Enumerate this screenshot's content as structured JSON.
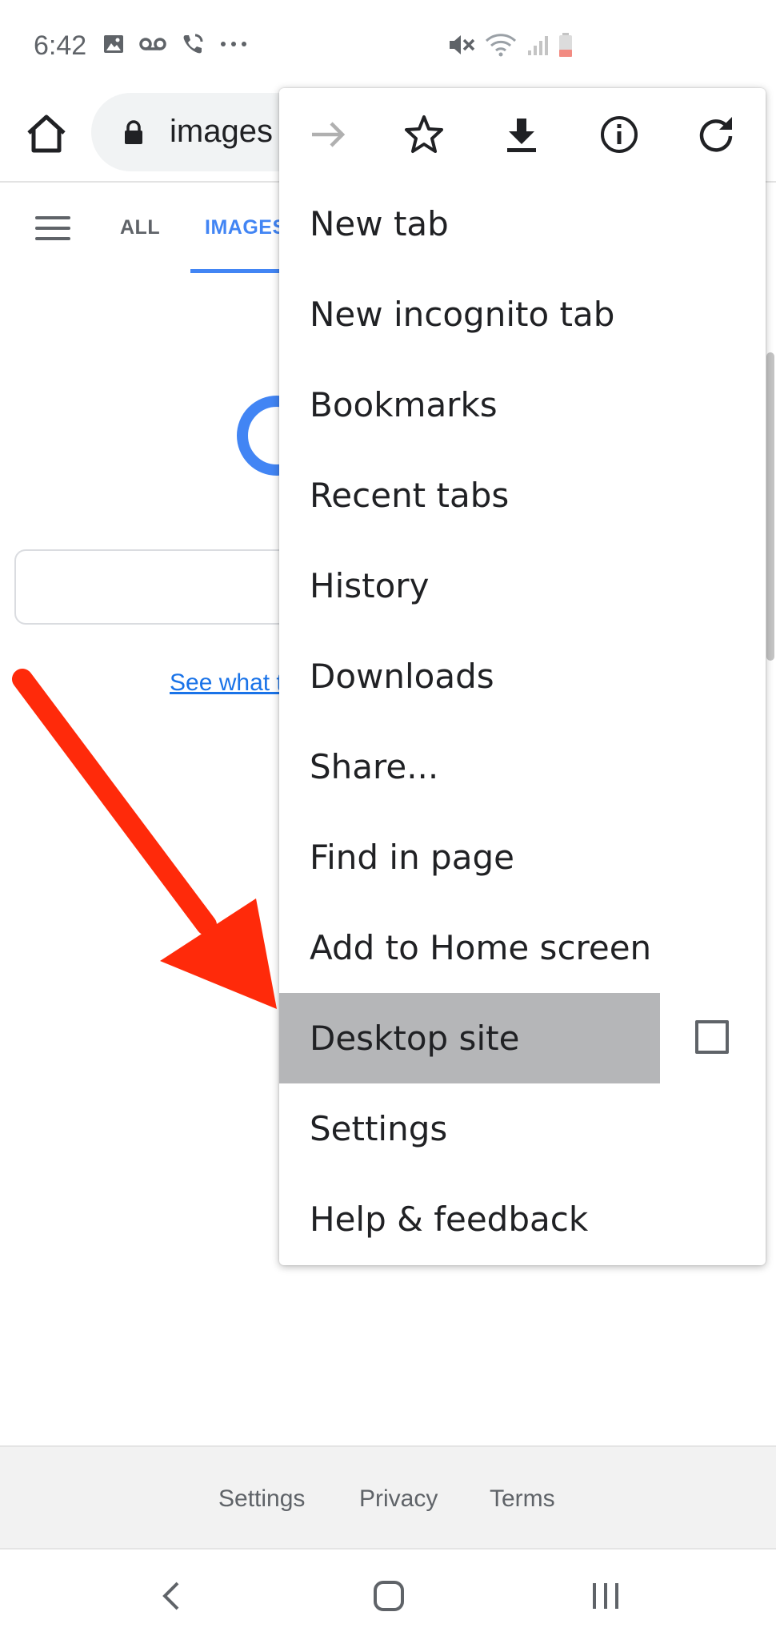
{
  "status_bar": {
    "time": "6:42",
    "left_icons": [
      "gallery-icon",
      "voicemail-icon",
      "wifi-calling-icon",
      "more-dots-icon"
    ],
    "right_icons": [
      "mute-icon",
      "wifi-icon",
      "signal-icon",
      "battery-low-icon"
    ]
  },
  "toolbar": {
    "url_text": "images",
    "icons": [
      "home-icon",
      "lock-icon"
    ]
  },
  "page": {
    "tabs": [
      "ALL",
      "IMAGES"
    ],
    "active_tab": "IMAGES",
    "link_text": "See what t"
  },
  "menu": {
    "top_icons": [
      "forward-icon",
      "star-icon",
      "download-icon",
      "info-icon",
      "refresh-icon"
    ],
    "items": [
      {
        "label": "New tab"
      },
      {
        "label": "New incognito tab"
      },
      {
        "label": "Bookmarks"
      },
      {
        "label": "Recent tabs"
      },
      {
        "label": "History"
      },
      {
        "label": "Downloads"
      },
      {
        "label": "Share..."
      },
      {
        "label": "Find in page"
      },
      {
        "label": "Add to Home screen"
      },
      {
        "label": "Desktop site",
        "highlighted": true,
        "checkbox": false
      },
      {
        "label": "Settings"
      },
      {
        "label": "Help & feedback"
      }
    ]
  },
  "footer": {
    "links": [
      "Settings",
      "Privacy",
      "Terms"
    ]
  },
  "nav_bar": {
    "icons": [
      "back-icon",
      "home-nav-icon",
      "recents-icon"
    ]
  },
  "colors": {
    "accent_blue": "#4285f4",
    "highlight_gray": "#b5b6b8",
    "annotation_red": "#ff2a0a"
  }
}
